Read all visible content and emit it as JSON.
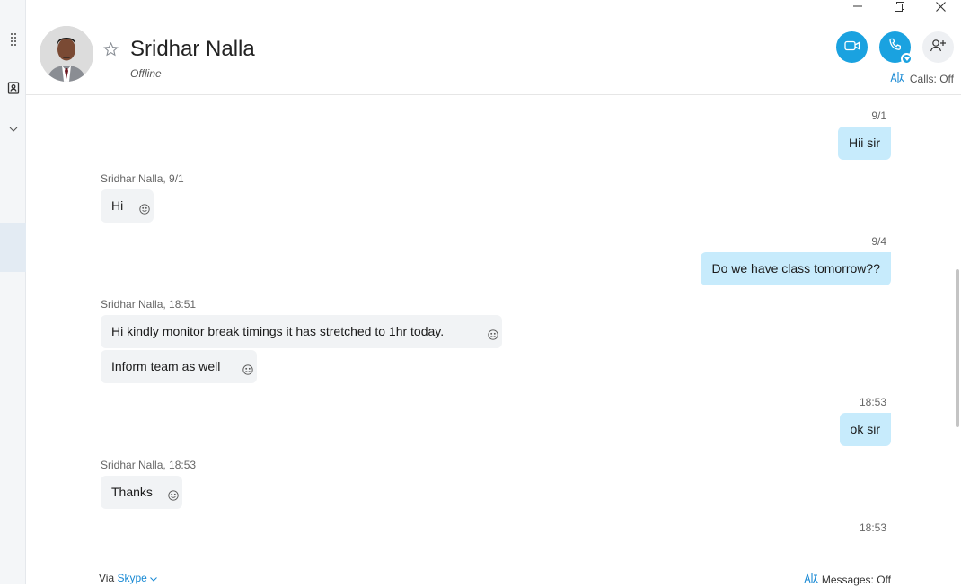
{
  "contact": {
    "name": "Sridhar Nalla",
    "status": "Offline"
  },
  "header": {
    "calls_label": "Calls: Off"
  },
  "messages": [
    {
      "direction": "out",
      "time": "9/1",
      "text": "Hii sir"
    },
    {
      "direction": "in",
      "meta": "Sridhar Nalla, 9/1",
      "text": "Hi"
    },
    {
      "direction": "out",
      "time": "9/4",
      "text": "Do we have class tomorrow??"
    },
    {
      "direction": "in",
      "meta": "Sridhar Nalla, 18:51",
      "text": "Hi kindly monitor break timings it has stretched to 1hr today."
    },
    {
      "direction": "in",
      "text": "Inform team as well"
    },
    {
      "direction": "out",
      "time": "18:53",
      "text": "ok sir"
    },
    {
      "direction": "in",
      "meta": "Sridhar Nalla, 18:53",
      "text": "Thanks"
    },
    {
      "direction": "out",
      "time": "18:53"
    }
  ],
  "footer": {
    "via": "Via",
    "via_link": "Skype",
    "messages_label": "Messages: Off"
  },
  "colors": {
    "accent": "#1aa2e0",
    "outgoing_bubble": "#c7ebfc",
    "incoming_bubble": "#f1f3f5"
  },
  "icons": [
    "grid-icon",
    "contacts-icon",
    "chevron-down-icon",
    "minimize-icon",
    "restore-icon",
    "close-icon",
    "star-icon",
    "video-call-icon",
    "audio-call-icon",
    "add-people-icon",
    "translate-icon",
    "emoji-reaction-icon"
  ]
}
